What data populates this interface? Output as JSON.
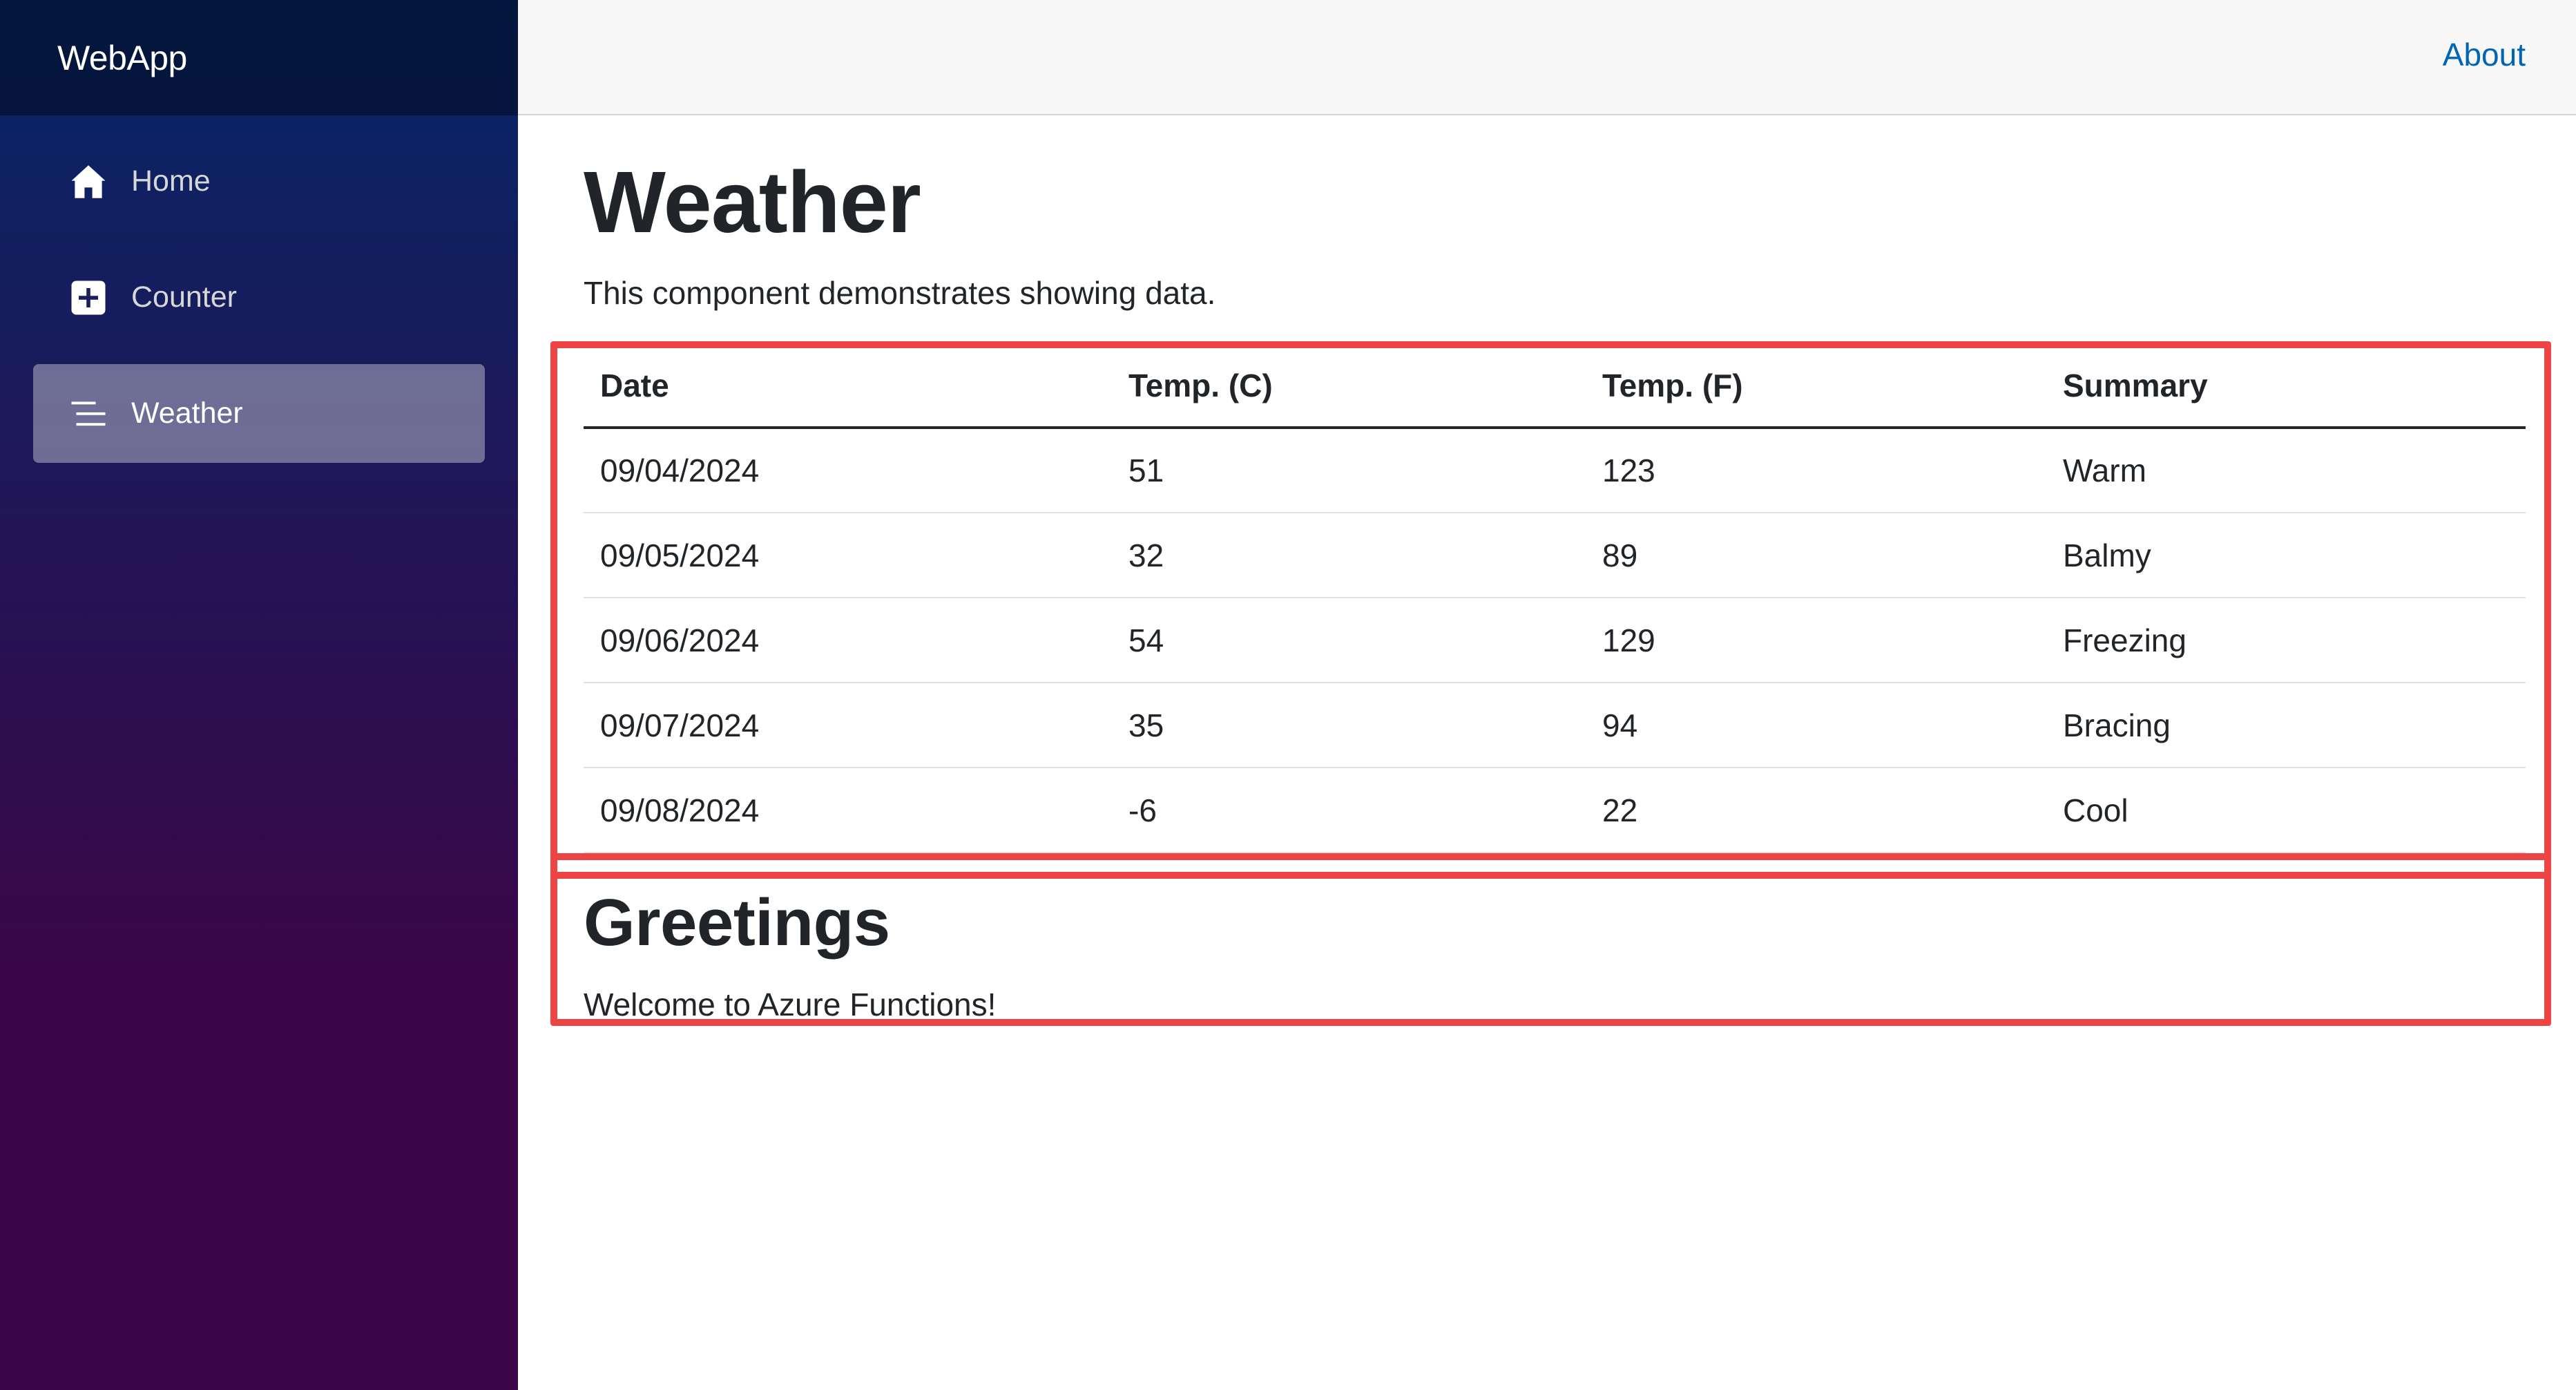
{
  "app": {
    "brand": "WebApp"
  },
  "sidebar": {
    "items": [
      {
        "label": "Home",
        "icon": "home-icon",
        "active": false
      },
      {
        "label": "Counter",
        "icon": "plus-square-icon",
        "active": false
      },
      {
        "label": "Weather",
        "icon": "list-icon",
        "active": true
      }
    ]
  },
  "topbar": {
    "about_label": "About"
  },
  "page": {
    "title": "Weather",
    "subtitle": "This component demonstrates showing data."
  },
  "table": {
    "headers": [
      "Date",
      "Temp. (C)",
      "Temp. (F)",
      "Summary"
    ],
    "rows": [
      [
        "09/04/2024",
        "51",
        "123",
        "Warm"
      ],
      [
        "09/05/2024",
        "32",
        "89",
        "Balmy"
      ],
      [
        "09/06/2024",
        "54",
        "129",
        "Freezing"
      ],
      [
        "09/07/2024",
        "35",
        "94",
        "Bracing"
      ],
      [
        "09/08/2024",
        "-6",
        "22",
        "Cool"
      ]
    ]
  },
  "greetings": {
    "title": "Greetings",
    "message": "Welcome to Azure Functions!"
  },
  "colors": {
    "sidebar_top": "#052767",
    "sidebar_bottom": "#3a0647",
    "link": "#0066b3",
    "highlight": "#ef4444"
  }
}
